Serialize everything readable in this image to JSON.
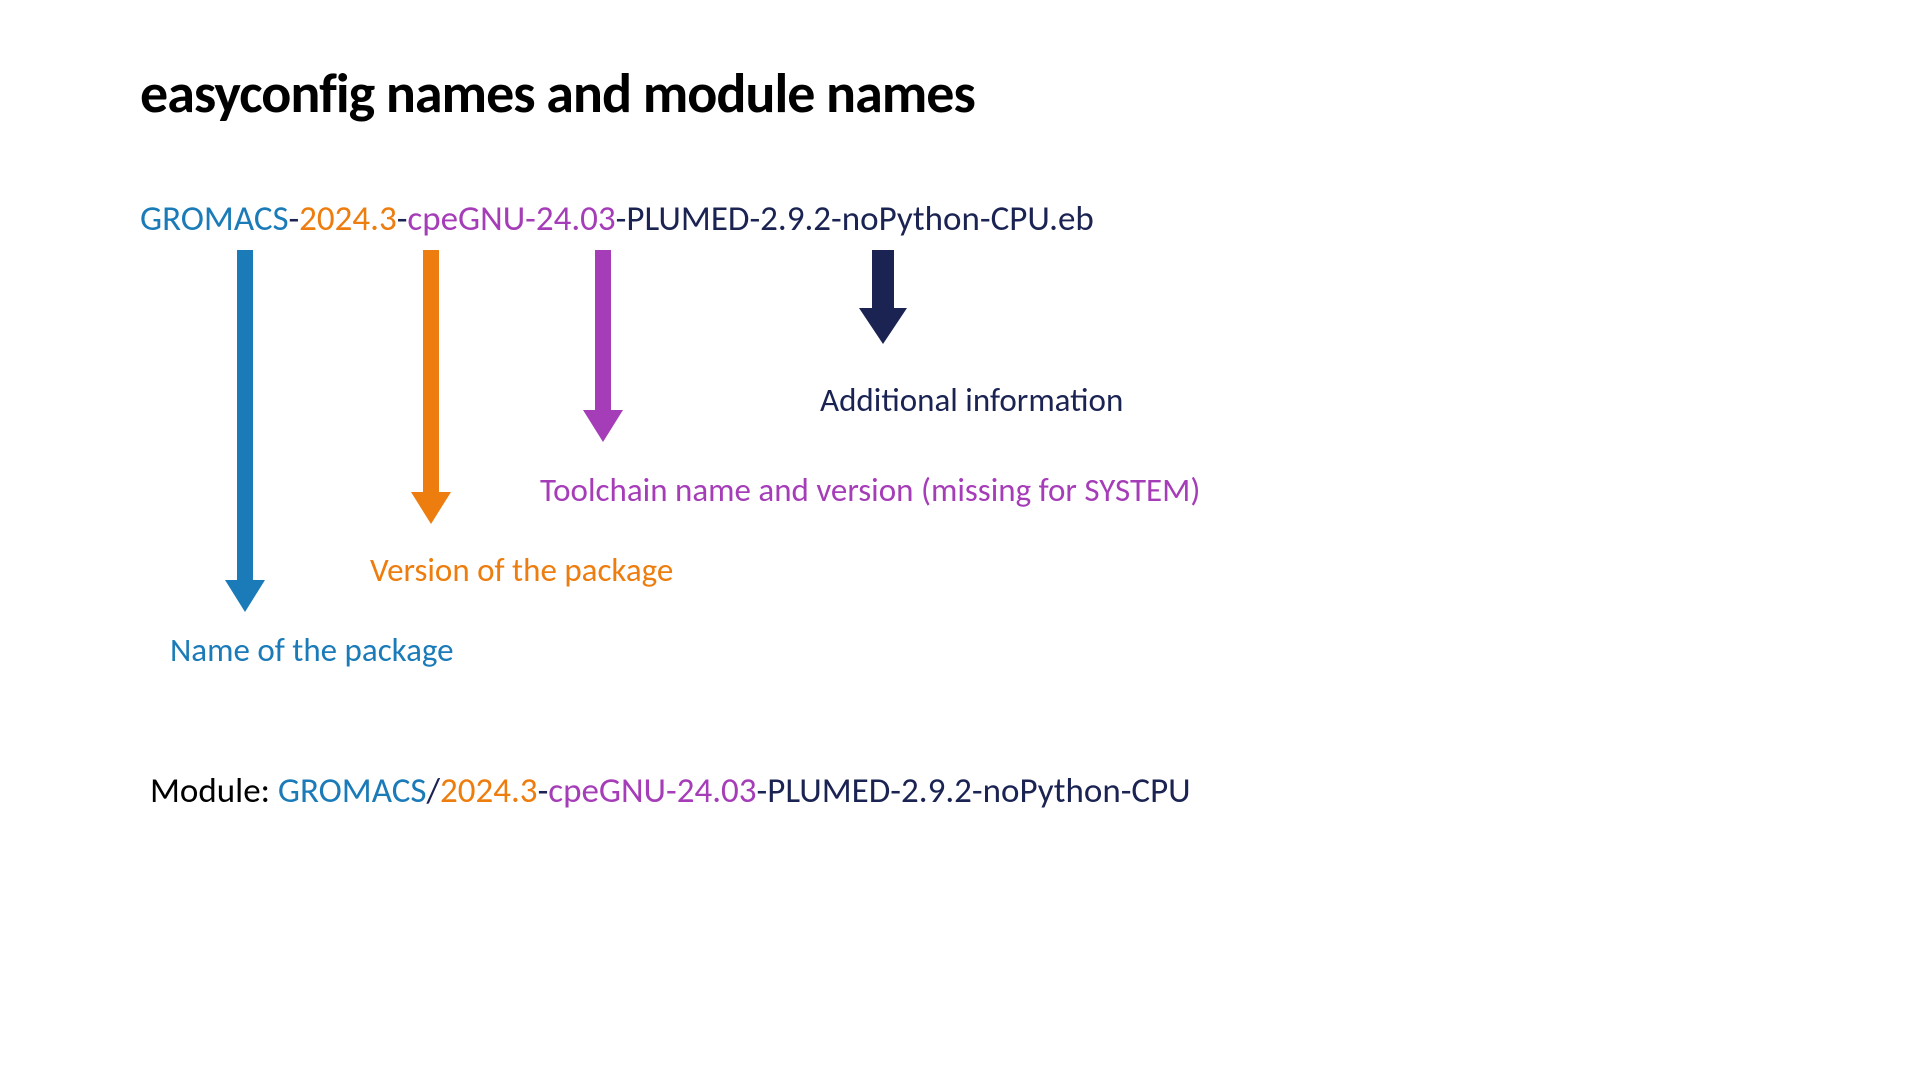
{
  "title": "easyconfig names and module names",
  "filename": {
    "name": "GROMACS",
    "sep1": "-",
    "version": "2024.3",
    "sep2": "-",
    "toolchain": "cpeGNU-24.03",
    "sep3": "-",
    "additional": "PLUMED-2.9.2-noPython-CPU",
    "ext": ".eb"
  },
  "labels": {
    "additional": "Additional information",
    "toolchain": "Toolchain name and version (missing for SYSTEM)",
    "version": "Version of the package",
    "name": "Name of the package"
  },
  "module": {
    "prefix": "Module: ",
    "name": "GROMACS",
    "slash": "/",
    "version": "2024.3",
    "sep1": "-",
    "toolchain": "cpeGNU-24.03",
    "sep2": "-",
    "additional": "PLUMED-2.9.2-noPython-CPU"
  },
  "colors": {
    "blue": "#1a7bb8",
    "orange": "#ed7d0e",
    "purple": "#a63db8",
    "navy": "#1a2352"
  }
}
